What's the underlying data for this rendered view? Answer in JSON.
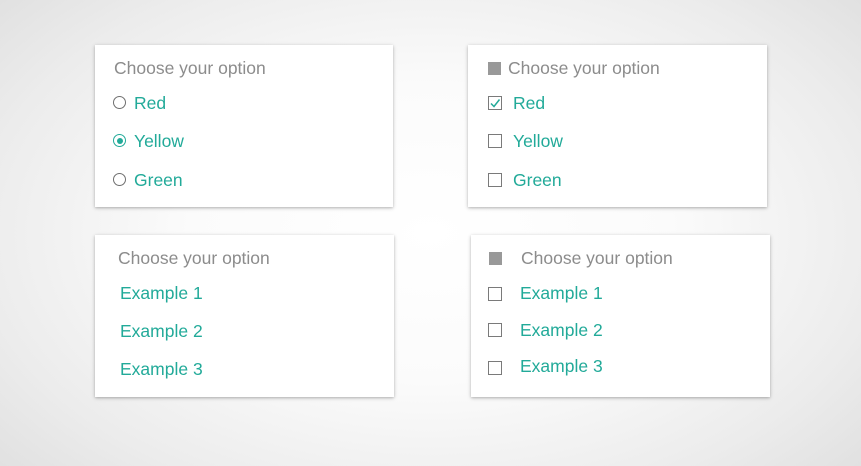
{
  "colors": {
    "accent": "#22aa99",
    "header_text": "#8c8c8c",
    "control_border": "#6f6f6f",
    "header_square": "#999999",
    "card_background": "#ffffff"
  },
  "radio_card": {
    "header": "Choose your option",
    "options": [
      {
        "label": "Red",
        "checked": false
      },
      {
        "label": "Yellow",
        "checked": true
      },
      {
        "label": "Green",
        "checked": false
      }
    ]
  },
  "checkbox_card": {
    "header_icon": "filled-square-icon",
    "header": "Choose your option",
    "options": [
      {
        "label": "Red",
        "checked": true
      },
      {
        "label": "Yellow",
        "checked": false
      },
      {
        "label": "Green",
        "checked": false
      }
    ]
  },
  "list_card": {
    "header": "Choose your option",
    "options": [
      {
        "label": "Example 1"
      },
      {
        "label": "Example 2"
      },
      {
        "label": "Example 3"
      }
    ]
  },
  "checkbox_list_card": {
    "header_icon": "filled-square-icon",
    "header": "Choose your option",
    "options": [
      {
        "label": "Example 1",
        "checked": false
      },
      {
        "label": "Example 2",
        "checked": false
      },
      {
        "label": "Example 3",
        "checked": false
      }
    ]
  }
}
